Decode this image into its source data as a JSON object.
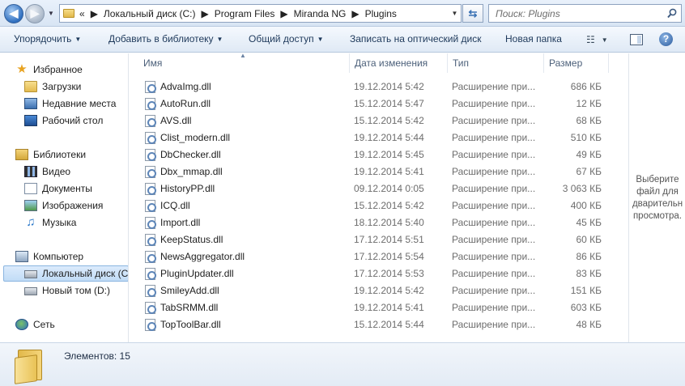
{
  "address": {
    "overflow": "«",
    "crumbs": [
      "Локальный диск (C:)",
      "Program Files",
      "Miranda NG",
      "Plugins"
    ],
    "search_placeholder": "Поиск: Plugins"
  },
  "toolbar": {
    "organize": "Упорядочить",
    "add_to_library": "Добавить в библиотеку",
    "share": "Общий доступ",
    "burn": "Записать на оптический диск",
    "new_folder": "Новая папка"
  },
  "nav": {
    "favorites": "Избранное",
    "downloads": "Загрузки",
    "recent": "Недавние места",
    "desktop": "Рабочий стол",
    "libraries": "Библиотеки",
    "video": "Видео",
    "documents": "Документы",
    "pictures": "Изображения",
    "music": "Музыка",
    "computer": "Компьютер",
    "local_disk": "Локальный диск (C",
    "new_volume": "Новый том (D:)",
    "network": "Сеть"
  },
  "columns": {
    "name": "Имя",
    "date": "Дата изменения",
    "type": "Тип",
    "size": "Размер"
  },
  "files": [
    {
      "name": "AdvaImg.dll",
      "date": "19.12.2014 5:42",
      "type": "Расширение при...",
      "size": "686 КБ"
    },
    {
      "name": "AutoRun.dll",
      "date": "15.12.2014 5:47",
      "type": "Расширение при...",
      "size": "12 КБ"
    },
    {
      "name": "AVS.dll",
      "date": "15.12.2014 5:42",
      "type": "Расширение при...",
      "size": "68 КБ"
    },
    {
      "name": "Clist_modern.dll",
      "date": "19.12.2014 5:44",
      "type": "Расширение при...",
      "size": "510 КБ"
    },
    {
      "name": "DbChecker.dll",
      "date": "19.12.2014 5:45",
      "type": "Расширение при...",
      "size": "49 КБ"
    },
    {
      "name": "Dbx_mmap.dll",
      "date": "19.12.2014 5:41",
      "type": "Расширение при...",
      "size": "67 КБ"
    },
    {
      "name": "HistoryPP.dll",
      "date": "09.12.2014 0:05",
      "type": "Расширение при...",
      "size": "3 063 КБ"
    },
    {
      "name": "ICQ.dll",
      "date": "15.12.2014 5:42",
      "type": "Расширение при...",
      "size": "400 КБ"
    },
    {
      "name": "Import.dll",
      "date": "18.12.2014 5:40",
      "type": "Расширение при...",
      "size": "45 КБ"
    },
    {
      "name": "KeepStatus.dll",
      "date": "17.12.2014 5:51",
      "type": "Расширение при...",
      "size": "60 КБ"
    },
    {
      "name": "NewsAggregator.dll",
      "date": "17.12.2014 5:54",
      "type": "Расширение при...",
      "size": "86 КБ"
    },
    {
      "name": "PluginUpdater.dll",
      "date": "17.12.2014 5:53",
      "type": "Расширение при...",
      "size": "83 КБ"
    },
    {
      "name": "SmileyAdd.dll",
      "date": "19.12.2014 5:42",
      "type": "Расширение при...",
      "size": "151 КБ"
    },
    {
      "name": "TabSRMM.dll",
      "date": "19.12.2014 5:41",
      "type": "Расширение при...",
      "size": "603 КБ"
    },
    {
      "name": "TopToolBar.dll",
      "date": "15.12.2014 5:44",
      "type": "Расширение при...",
      "size": "48 КБ"
    }
  ],
  "preview_text": "Выберите файл для дварительн просмотра.",
  "status": {
    "items_count": "Элементов: 15"
  }
}
